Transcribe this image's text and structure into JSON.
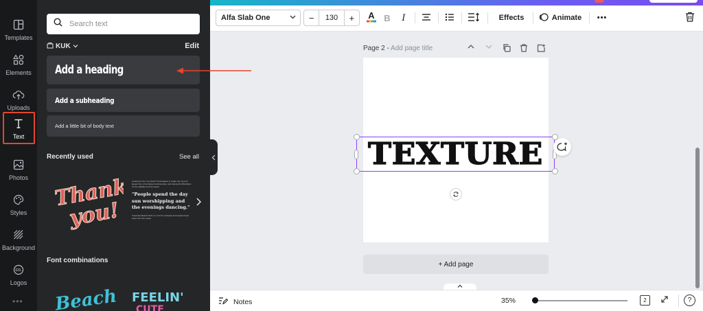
{
  "sidebar": {
    "items": [
      {
        "label": "Templates",
        "icon": "templates-icon"
      },
      {
        "label": "Elements",
        "icon": "elements-icon"
      },
      {
        "label": "Uploads",
        "icon": "uploads-icon"
      },
      {
        "label": "Text",
        "icon": "text-icon",
        "active": true
      },
      {
        "label": "Photos",
        "icon": "photos-icon"
      },
      {
        "label": "Styles",
        "icon": "styles-icon"
      },
      {
        "label": "Background",
        "icon": "background-icon"
      },
      {
        "label": "Logos",
        "icon": "logos-icon"
      }
    ],
    "more": "•••"
  },
  "panel": {
    "search_placeholder": "Search text",
    "brand_kit": "KUK",
    "edit_label": "Edit",
    "add_heading": "Add a heading",
    "add_subheading": "Add a subheading",
    "add_body": "Add a little bit of body text",
    "recently_used_title": "Recently used",
    "see_all": "See all",
    "recent_thumb_1": {
      "line1": "Thank",
      "line2": "you!"
    },
    "recent_thumb_2": {
      "small": "Looking for the 'new Ibiza'? Portosapolo in Inside, the second largest city in the Santa Carolina state, and beloved by Brazilians for the nightlife and the beach.",
      "quote": "\"People spend the day sun worshipping and the evenings dancing.\"",
      "foot": "Tropicana Beach Club is a must for samples and weekend just steps from the ocean."
    },
    "font_combinations_title": "Font combinations",
    "combo_1": "Beach",
    "combo_2": "FEELIN'",
    "combo_2_sub": "CUTE"
  },
  "toolbar": {
    "font_name": "Alfa Slab One",
    "font_size": "130",
    "minus": "−",
    "plus": "+",
    "effects_label": "Effects",
    "animate_label": "Animate",
    "more": "•••"
  },
  "canvas": {
    "page_label": "Page 2 - ",
    "page_title_placeholder": "Add page title",
    "text_content": "TEXTURE",
    "add_page_label": "+ Add page"
  },
  "bottombar": {
    "notes_label": "Notes",
    "zoom": "35%",
    "zoom_fraction": 0.0,
    "page_count": "2",
    "help": "?"
  },
  "colors": {
    "accent_selection": "#8b3dff",
    "annotation": "#e5452f",
    "sidebar_bg": "#18191b",
    "panel_bg": "#252627"
  }
}
